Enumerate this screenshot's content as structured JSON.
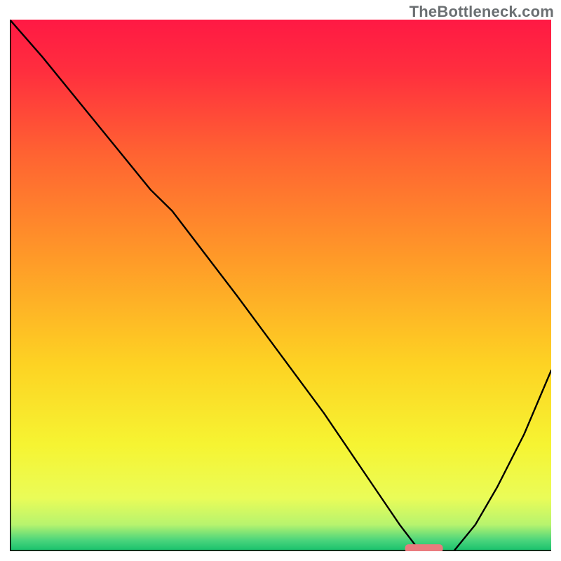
{
  "watermark": "TheBottleneck.com",
  "chart_data": {
    "type": "line",
    "title": "",
    "xlabel": "",
    "ylabel": "",
    "xlim": [
      0,
      100
    ],
    "ylim": [
      0,
      100
    ],
    "grid": false,
    "legend": false,
    "gradient_stops": [
      {
        "pct": 0,
        "color": "#ff1944"
      },
      {
        "pct": 10,
        "color": "#ff2f3e"
      },
      {
        "pct": 25,
        "color": "#ff6232"
      },
      {
        "pct": 45,
        "color": "#ff9a28"
      },
      {
        "pct": 65,
        "color": "#fdd323"
      },
      {
        "pct": 80,
        "color": "#f6f432"
      },
      {
        "pct": 90,
        "color": "#eafc58"
      },
      {
        "pct": 95,
        "color": "#b7f46e"
      },
      {
        "pct": 98,
        "color": "#49d47c"
      },
      {
        "pct": 100,
        "color": "#15c06b"
      }
    ],
    "curve": {
      "name": "bottleneck-curve",
      "color": "#000000",
      "x": [
        0,
        6,
        14,
        22,
        26,
        30,
        36,
        42,
        50,
        58,
        64,
        68,
        72,
        75,
        78,
        82,
        86,
        90,
        95,
        100
      ],
      "y": [
        100,
        93,
        83,
        73,
        68,
        64,
        56,
        48,
        37,
        26,
        17,
        11,
        5,
        1,
        0,
        0,
        5,
        12,
        22,
        34
      ]
    },
    "marker": {
      "name": "optimal-zone",
      "shape": "rounded-rect",
      "color": "#e97b7e",
      "x_center": 76.5,
      "y_center": 0.5,
      "width": 7,
      "height": 1.6
    },
    "axes_color": "#000000"
  }
}
